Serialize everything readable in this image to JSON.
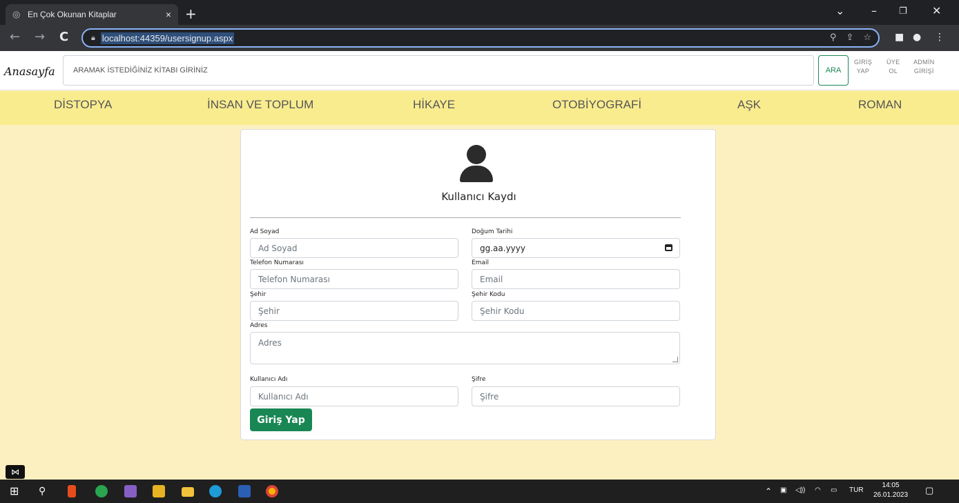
{
  "browser": {
    "tab_title": "En Çok Okunan Kitaplar",
    "tab_close": "×",
    "new_tab": "+",
    "url": "localhost:44359/usersignup.aspx"
  },
  "nav": {
    "brand": "Anasayfa",
    "search_placeholder": "ARAMAK İSTEDİĞİNİZ KİTABI GİRİNİZ",
    "search_button": "ARA",
    "login_line1": "GİRİŞ",
    "login_line2": "YAP",
    "signup_line1": "ÜYE",
    "signup_line2": "OL",
    "admin_line1": "ADMİN",
    "admin_line2": "GİRİŞİ"
  },
  "categories": [
    "DİSTOPYA",
    "İNSAN VE TOPLUM",
    "HİKAYE",
    "OTOBİYOGRAFİ",
    "AŞK",
    "ROMAN"
  ],
  "form": {
    "title": "Kullanıcı Kaydı",
    "fullname": {
      "label": "Ad Soyad",
      "placeholder": "Ad Soyad"
    },
    "birthdate": {
      "label": "Doğum Tarihi",
      "value": "gg.aa.yyyy"
    },
    "phone": {
      "label": "Telefon Numarası",
      "placeholder": "Telefon Numarası"
    },
    "email": {
      "label": "Email",
      "placeholder": "Email"
    },
    "city": {
      "label": "Şehir",
      "placeholder": "Şehir"
    },
    "city_code": {
      "label": "Şehir Kodu",
      "placeholder": "Şehir Kodu"
    },
    "address": {
      "label": "Adres",
      "placeholder": "Adres"
    },
    "username": {
      "label": "Kullanıcı Adı",
      "placeholder": "Kullanıcı Adı"
    },
    "password": {
      "label": "Şifre",
      "placeholder": "Şifre"
    },
    "submit": "Giriş Yap"
  },
  "taskbar": {
    "language": "TUR",
    "time": "14:05",
    "date": "26.01.2023"
  },
  "colors": {
    "page_bg": "#fdf0c0",
    "category_bar": "#f9ec8f",
    "accent_green": "#198754"
  }
}
